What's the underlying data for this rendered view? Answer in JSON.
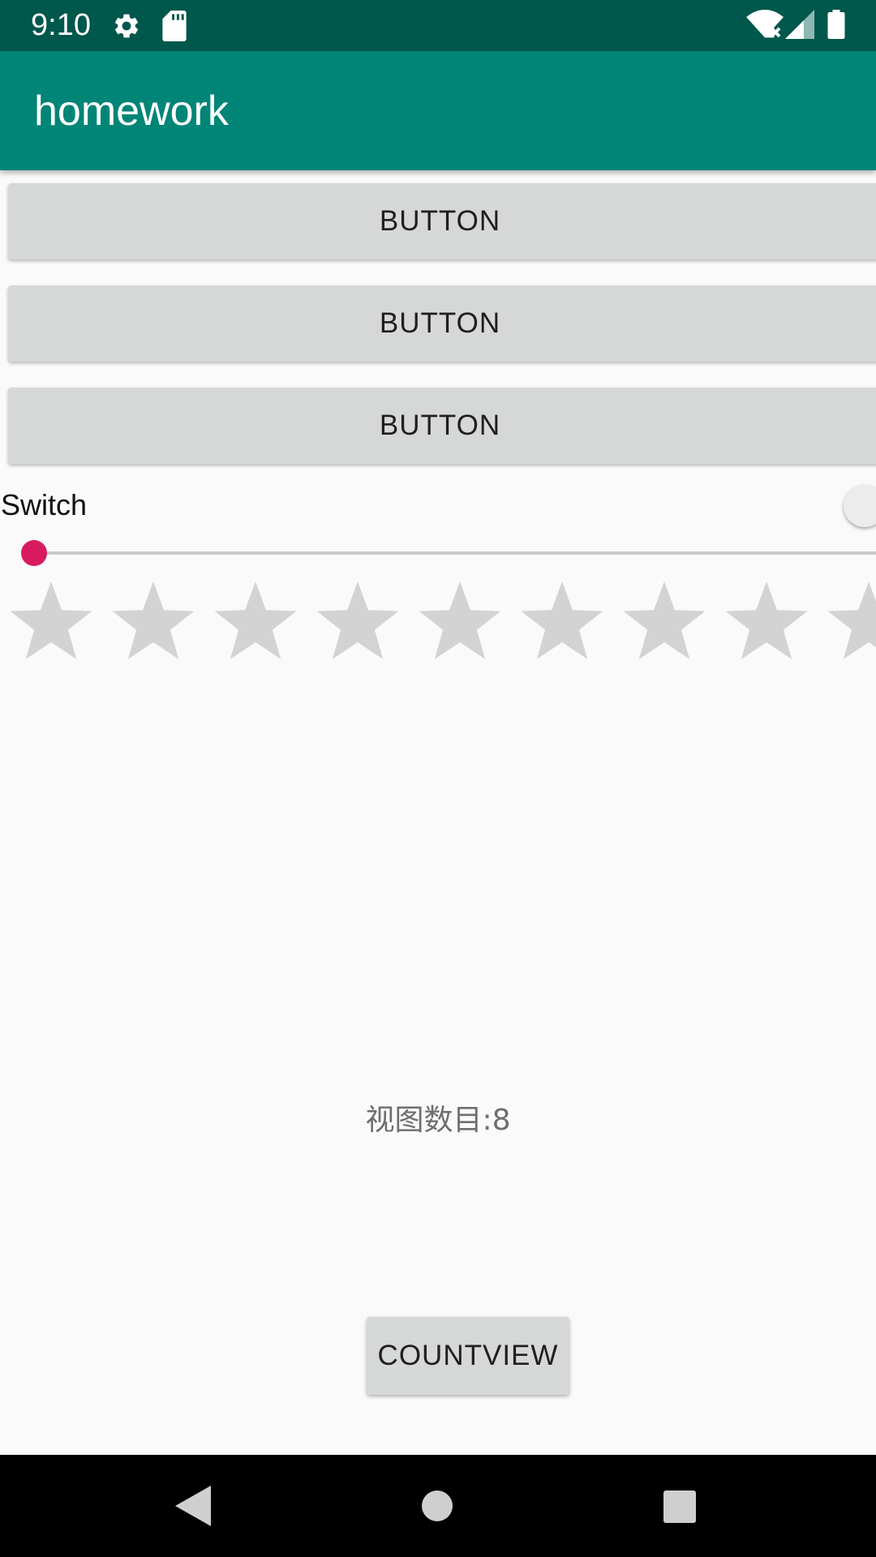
{
  "status_bar": {
    "time": "9:10",
    "icons": [
      "gear-icon",
      "sd-card-icon",
      "wifi-icon",
      "signal-icon",
      "battery-icon"
    ]
  },
  "app_bar": {
    "title": "homework",
    "color": "#008577"
  },
  "buttons": [
    {
      "label": "BUTTON"
    },
    {
      "label": "BUTTON"
    },
    {
      "label": "BUTTON"
    }
  ],
  "switch": {
    "label": "Switch",
    "checked": false
  },
  "seekbar": {
    "progress": 0,
    "accent_color": "#d81b60"
  },
  "rating_bar": {
    "num_stars": 9,
    "rating": 0,
    "star_color": "#d3d3d3"
  },
  "count_text": "视图数目:8",
  "countview_button": {
    "label": "COUNTVIEW"
  },
  "nav_bar": {
    "icons": [
      "back-icon",
      "home-icon",
      "recents-icon"
    ]
  }
}
